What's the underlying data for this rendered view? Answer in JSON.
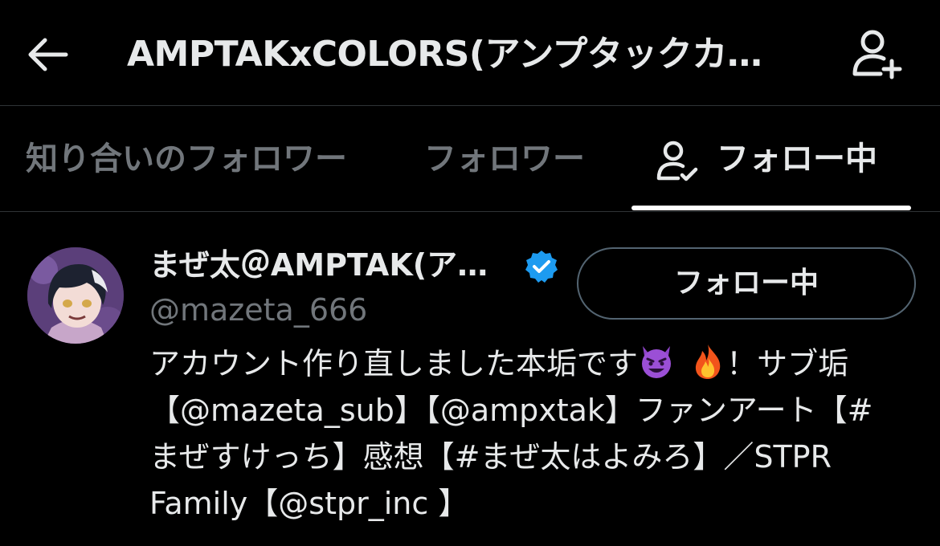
{
  "header": {
    "title": "AMPTAKxCOLORS(アンプタックカ…",
    "back_icon": "arrow-left-icon",
    "add_user_icon": "person-plus-icon"
  },
  "tabs": [
    {
      "label": "知り合いのフォロワー",
      "active": false
    },
    {
      "label": "フォロワー",
      "active": false
    },
    {
      "label": "フォロー中",
      "active": true,
      "icon": "person-check-icon"
    }
  ],
  "users": [
    {
      "display_name": "まぜ太＠AMPTAK(ア…",
      "verified": true,
      "handle": "@mazeta_666",
      "follow_button": "フォロー中",
      "bio_lines": [
        {
          "before": "アカウント作り直しました本垢です",
          "after": "！サブ垢"
        },
        {
          "text": "【@mazeta_sub】【@ampxtak】ファンアート【#"
        },
        {
          "text": "まぜすけっち】感想【#まぜ太はよみろ】／STPR"
        },
        {
          "text": "Family【@stpr_inc 】"
        }
      ],
      "bio_emojis": [
        "smiling-devil-emoji",
        "fire-emoji"
      ]
    }
  ],
  "colors": {
    "background": "#000000",
    "text_primary": "#e7e9ea",
    "text_secondary": "#71767b",
    "verified": "#1d9bf0",
    "divider": "#2f3336"
  }
}
